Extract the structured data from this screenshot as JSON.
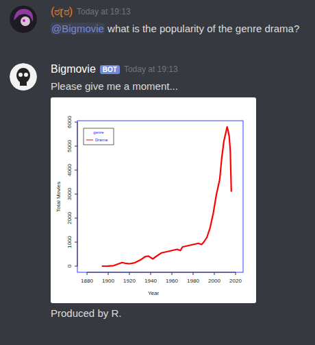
{
  "messages": [
    {
      "author": "(ಠɽಠ)",
      "author_color": "#e67e22",
      "bot": false,
      "timestamp": "Today at 19:13",
      "mention": "@Bigmovie",
      "text": " what is the popularity of the genre drama?"
    },
    {
      "author": "Bigmovie",
      "author_color": "#ffffff",
      "bot": true,
      "badge": "BOT",
      "timestamp": "Today at 19:13",
      "text": "Please give me a moment...",
      "footer": "Produced by R."
    }
  ],
  "chart": {
    "x_label": "Year",
    "y_label": "Total Movies",
    "x_ticks": [
      "1880",
      "1900",
      "1920",
      "1940",
      "1960",
      "1980",
      "2000",
      "2020"
    ],
    "y_ticks": [
      "0",
      "1000",
      "2000",
      "3000",
      "4000",
      "5000",
      "6000"
    ],
    "legend": {
      "title": "genre",
      "items": [
        {
          "label": "Drama",
          "color": "#ff0000"
        }
      ]
    },
    "series": [
      {
        "name": "Drama",
        "color": "#ff0000",
        "years": [
          1894,
          1900,
          1905,
          1910,
          1913,
          1916,
          1920,
          1925,
          1930,
          1935,
          1938,
          1942,
          1945,
          1950,
          1955,
          1960,
          1965,
          1968,
          1970,
          1975,
          1980,
          1985,
          1988,
          1990,
          1993,
          1996,
          1999,
          2002,
          2005,
          2007,
          2009,
          2011,
          2012,
          2013,
          2014,
          2015,
          2016
        ],
        "values": [
          0,
          5,
          20,
          100,
          150,
          120,
          100,
          140,
          250,
          400,
          420,
          300,
          400,
          550,
          600,
          650,
          700,
          650,
          800,
          850,
          900,
          950,
          900,
          1000,
          1200,
          1600,
          2200,
          3000,
          3600,
          4500,
          5200,
          5600,
          5800,
          5650,
          5400,
          4800,
          3100
        ]
      }
    ]
  }
}
